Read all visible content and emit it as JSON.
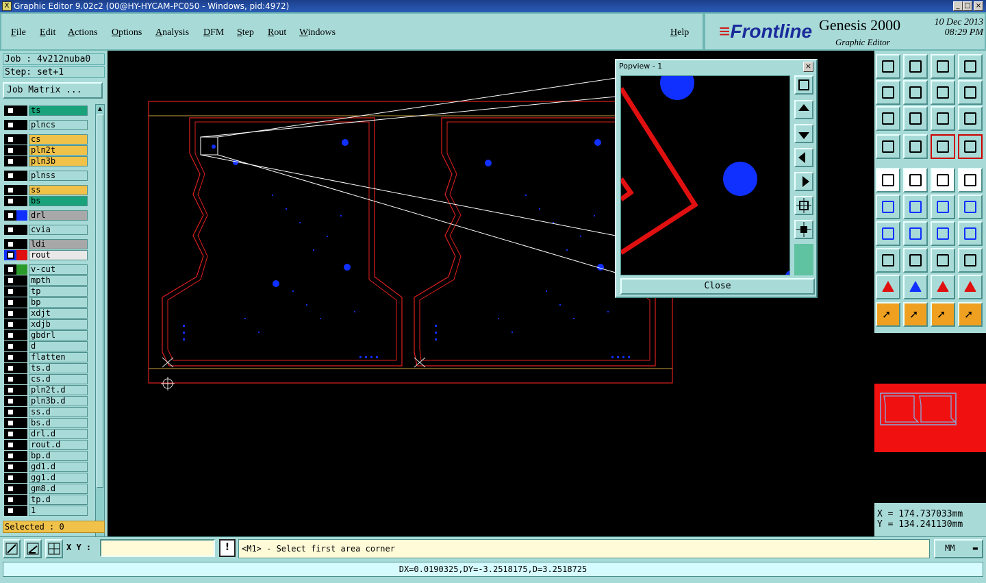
{
  "window": {
    "title": "Graphic Editor 9.02c2 (00@HY-HYCAM-PC050 - Windows, pid:4972)",
    "app_icon": "x-icon"
  },
  "menu": [
    "File",
    "Edit",
    "Actions",
    "Options",
    "Analysis",
    "DFM",
    "Step",
    "Rout",
    "Windows"
  ],
  "help": "Help",
  "brand": {
    "logo": "Frontline",
    "product": "Genesis 2000",
    "module": "Graphic Editor",
    "date": "10 Dec 2013",
    "time": "08:29 PM"
  },
  "job": {
    "job_label": "Job : 4v212nuba0",
    "step_label": "Step: set+1",
    "matrix_button": "Job Matrix ..."
  },
  "layers": [
    {
      "name": "ts",
      "color": "#1aa37a"
    },
    {
      "name": "plncs",
      "color": "#a8dbd8"
    },
    {
      "name": "cs",
      "color": "#f0c24a"
    },
    {
      "name": "pln2t",
      "color": "#f0c24a"
    },
    {
      "name": "pln3b",
      "color": "#f0c24a"
    },
    {
      "name": "plnss",
      "color": "#a8dbd8"
    },
    {
      "name": "ss",
      "color": "#f0c24a"
    },
    {
      "name": "bs",
      "color": "#1aa37a"
    },
    {
      "name": "drl",
      "color": "#a8a8a8"
    },
    {
      "name": "cvia",
      "color": "#a8dbd8"
    },
    {
      "name": "ldi",
      "color": "#a8a8a8"
    },
    {
      "name": "rout",
      "color": "#e8e8e8"
    },
    {
      "name": "v-cut",
      "color": "#a8dbd8"
    },
    {
      "name": "mpth",
      "color": "#a8dbd8"
    },
    {
      "name": "tp",
      "color": "#a8dbd8"
    },
    {
      "name": "bp",
      "color": "#a8dbd8"
    },
    {
      "name": "xdjt",
      "color": "#a8dbd8"
    },
    {
      "name": "xdjb",
      "color": "#a8dbd8"
    },
    {
      "name": "gbdrl",
      "color": "#a8dbd8"
    },
    {
      "name": "d",
      "color": "#a8dbd8"
    },
    {
      "name": "flatten",
      "color": "#a8dbd8"
    },
    {
      "name": "ts.d",
      "color": "#a8dbd8"
    },
    {
      "name": "cs.d",
      "color": "#a8dbd8"
    },
    {
      "name": "pln2t.d",
      "color": "#a8dbd8"
    },
    {
      "name": "pln3b.d",
      "color": "#a8dbd8"
    },
    {
      "name": "ss.d",
      "color": "#a8dbd8"
    },
    {
      "name": "bs.d",
      "color": "#a8dbd8"
    },
    {
      "name": "drl.d",
      "color": "#a8dbd8"
    },
    {
      "name": "rout.d",
      "color": "#a8dbd8"
    },
    {
      "name": "bp.d",
      "color": "#a8dbd8"
    },
    {
      "name": "gd1.d",
      "color": "#a8dbd8"
    },
    {
      "name": "gg1.d",
      "color": "#a8dbd8"
    },
    {
      "name": "gm8.d",
      "color": "#a8dbd8"
    },
    {
      "name": "tp.d",
      "color": "#a8dbd8"
    },
    {
      "name": "1",
      "color": "#a8dbd8"
    }
  ],
  "selected": "Selected : 0",
  "popview": {
    "title": "Popview - 1",
    "close_button": "Close"
  },
  "coords": {
    "x": "X = 174.737033mm",
    "y": "Y = 134.241130mm"
  },
  "bottom": {
    "xy_label": "X Y :",
    "xy_value": "",
    "prompt": "<M1> - Select first area corner",
    "units": "MM",
    "warn": "!"
  },
  "status": "DX=0.0190325,DY=-3.2518175,D=3.2518725"
}
